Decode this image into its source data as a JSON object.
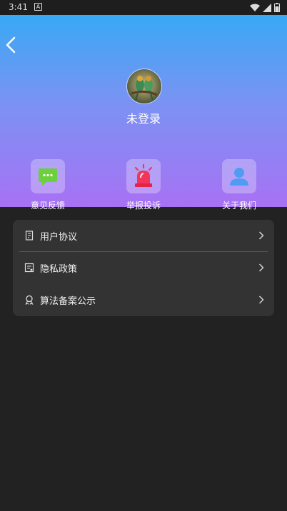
{
  "status_bar": {
    "time": "3:41",
    "notification_glyph": "A",
    "icons": [
      "wifi-icon",
      "signal-icon",
      "battery-icon"
    ]
  },
  "header": {
    "back_icon": "chevron-left-icon",
    "username": "未登录",
    "quick_actions": [
      {
        "label": "意见反馈",
        "icon": "chat-bubble-icon"
      },
      {
        "label": "举报投诉",
        "icon": "siren-alarm-icon"
      },
      {
        "label": "关于我们",
        "icon": "person-icon"
      }
    ]
  },
  "menu": {
    "items": [
      {
        "label": "用户协议",
        "icon": "document-icon"
      },
      {
        "label": "隐私政策",
        "icon": "policy-icon"
      },
      {
        "label": "算法备案公示",
        "icon": "award-ribbon-icon"
      }
    ]
  },
  "colors": {
    "header_gradient_top": "#38a9f5",
    "header_gradient_bottom": "#a871f4",
    "page_background": "#222222",
    "card_background": "#333333"
  }
}
